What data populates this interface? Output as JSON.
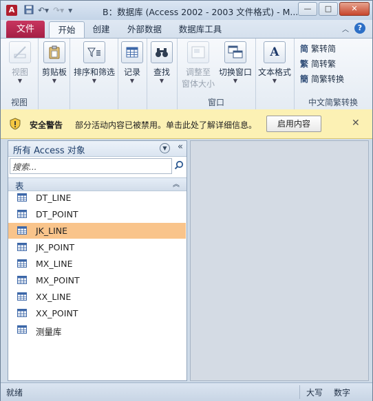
{
  "window": {
    "title": "B：数据库 (Access 2002 - 2003 文件格式) - M...",
    "app_icon": "A",
    "controls": {
      "minimize": "—",
      "maximize": "□",
      "close": "✕"
    }
  },
  "ribbon_tabs": [
    {
      "label": "文件"
    },
    {
      "label": "开始"
    },
    {
      "label": "创建"
    },
    {
      "label": "外部数据"
    },
    {
      "label": "数据库工具"
    }
  ],
  "ribbon": {
    "view_group": {
      "button": "视图",
      "label": "视图"
    },
    "clipboard": {
      "button": "剪贴板"
    },
    "sort_filter": {
      "button": "排序和筛选"
    },
    "records": {
      "button": "记录"
    },
    "find": {
      "button": "查找"
    },
    "window_group": {
      "adjust_line1": "调整至",
      "adjust_line2": "窗体大小",
      "switch": "切换窗口",
      "label": "窗口"
    },
    "text_format": {
      "button": "文本格式"
    },
    "chinese_conv": {
      "to_simplified": "繁转简",
      "to_traditional": "简转繁",
      "convert": "简繁转换",
      "label": "中文简繁转换"
    }
  },
  "message_bar": {
    "title": "安全警告",
    "text": "部分活动内容已被禁用。单击此处了解详细信息。",
    "button": "启用内容",
    "close": "✕"
  },
  "nav_pane": {
    "title": "所有 Access 对象",
    "search_placeholder": "搜索...",
    "section_label": "表",
    "items": [
      {
        "label": "DT_LINE"
      },
      {
        "label": "DT_POINT"
      },
      {
        "label": "JK_LINE"
      },
      {
        "label": "JK_POINT"
      },
      {
        "label": "MX_LINE"
      },
      {
        "label": "MX_POINT"
      },
      {
        "label": "XX_LINE"
      },
      {
        "label": "XX_POINT"
      },
      {
        "label": "测量库"
      }
    ],
    "selected_index": 2
  },
  "status_bar": {
    "left": "就绪",
    "caps": "大写",
    "num": "数字"
  },
  "colors": {
    "file_tab": "#b52650",
    "selected_item": "#f9c48b",
    "message_bar": "#fcf1b4"
  }
}
